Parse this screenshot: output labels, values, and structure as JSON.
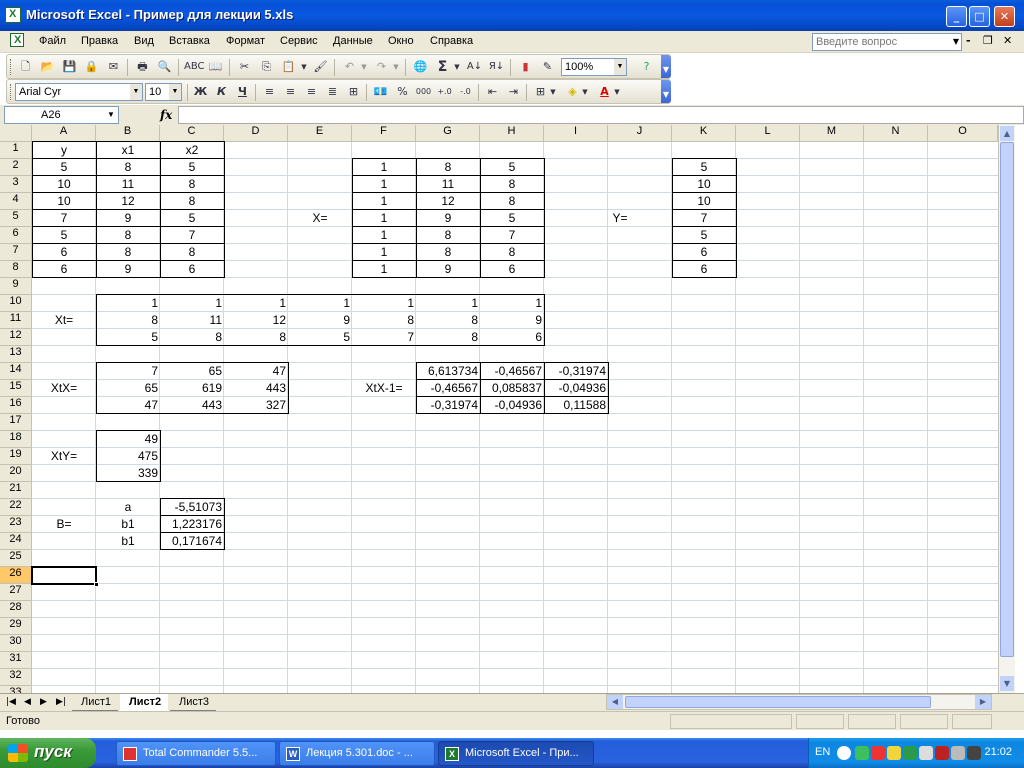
{
  "window": {
    "title": "Microsoft Excel - Пример для лекции 5.xls"
  },
  "menu": {
    "items": [
      "Файл",
      "Правка",
      "Вид",
      "Вставка",
      "Формат",
      "Сервис",
      "Данные",
      "Окно",
      "Справка"
    ],
    "question_placeholder": "Введите вопрос"
  },
  "toolbar": {
    "zoom": "100%",
    "font": "Arial Cyr",
    "size": "10",
    "bold": "Ж",
    "italic": "К",
    "underline": "Ч",
    "percent": "%",
    "thousands": "000",
    "fontcolor": "A",
    "sigma": "Σ"
  },
  "formula": {
    "namebox": "A26",
    "fx": "fx",
    "content": ""
  },
  "columns": [
    "A",
    "B",
    "C",
    "D",
    "E",
    "F",
    "G",
    "H",
    "I",
    "J",
    "K",
    "L",
    "M",
    "N",
    "O"
  ],
  "rows": [
    "1",
    "2",
    "3",
    "4",
    "5",
    "6",
    "7",
    "8",
    "9",
    "10",
    "11",
    "12",
    "13",
    "14",
    "15",
    "16",
    "17",
    "18",
    "19",
    "20",
    "21",
    "22",
    "23",
    "24",
    "25",
    "26",
    "27",
    "28",
    "29",
    "30",
    "31",
    "32",
    "33"
  ],
  "active_row": "26",
  "sheet": {
    "y_header": "y",
    "x1_header": "x1",
    "x2_header": "x2",
    "y": [
      "5",
      "10",
      "10",
      "7",
      "5",
      "6",
      "6"
    ],
    "x1": [
      "8",
      "11",
      "12",
      "9",
      "8",
      "8",
      "9"
    ],
    "x2": [
      "5",
      "8",
      "8",
      "5",
      "7",
      "8",
      "6"
    ],
    "X_label": "X=",
    "X": [
      [
        "1",
        "8",
        "5"
      ],
      [
        "1",
        "11",
        "8"
      ],
      [
        "1",
        "12",
        "8"
      ],
      [
        "1",
        "9",
        "5"
      ],
      [
        "1",
        "8",
        "7"
      ],
      [
        "1",
        "8",
        "8"
      ],
      [
        "1",
        "9",
        "6"
      ]
    ],
    "Y_label": "Y=",
    "Y": [
      "5",
      "10",
      "10",
      "7",
      "5",
      "6",
      "6"
    ],
    "Xt_label": "Xt=",
    "Xt": [
      [
        "1",
        "1",
        "1",
        "1",
        "1",
        "1",
        "1"
      ],
      [
        "8",
        "11",
        "12",
        "9",
        "8",
        "8",
        "9"
      ],
      [
        "5",
        "8",
        "8",
        "5",
        "7",
        "8",
        "6"
      ]
    ],
    "XtX_label": "XtX=",
    "XtX": [
      [
        "7",
        "65",
        "47"
      ],
      [
        "65",
        "619",
        "443"
      ],
      [
        "47",
        "443",
        "327"
      ]
    ],
    "XtXinv_label": "XtX-1=",
    "XtXinv": [
      [
        "6,613734",
        "-0,46567",
        "-0,31974"
      ],
      [
        "-0,46567",
        "0,085837",
        "-0,04936"
      ],
      [
        "-0,31974",
        "-0,04936",
        "0,11588"
      ]
    ],
    "XtY_label": "XtY=",
    "XtY": [
      "49",
      "475",
      "339"
    ],
    "B_label": "B=",
    "B_names": [
      "a",
      "b1",
      "b1"
    ],
    "B_values": [
      "-5,51073",
      "1,223176",
      "0,171674"
    ]
  },
  "sheets": {
    "tabs": [
      "Лист1",
      "Лист2",
      "Лист3"
    ],
    "active": "Лист2"
  },
  "status": {
    "text": "Готово"
  },
  "taskbar": {
    "start": "пуск",
    "tasks": [
      "Total Commander 5.5...",
      "Лекция 5.301.doc - ...",
      "Microsoft Excel - При..."
    ],
    "lang": "EN",
    "clock": "21:02"
  }
}
